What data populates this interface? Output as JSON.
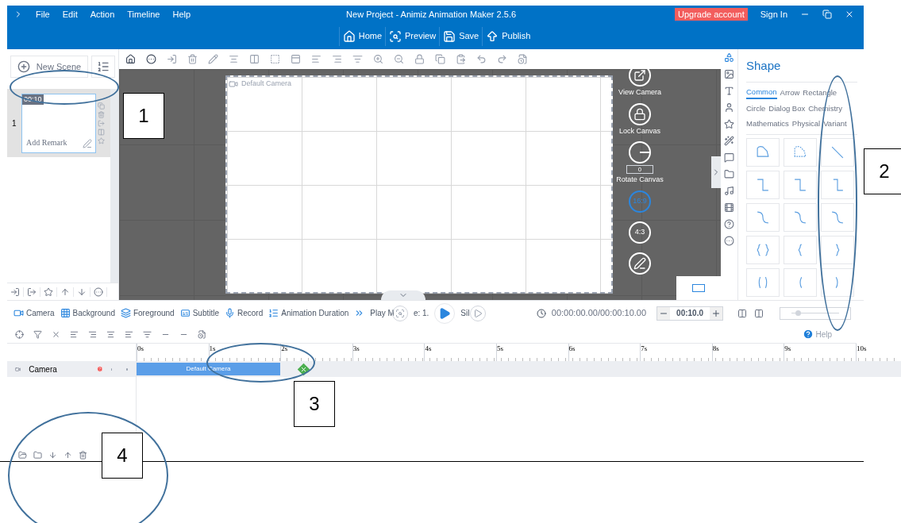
{
  "window": {
    "title": "New Project - Animiz Animation Maker 2.5.6",
    "upgrade": "Upgrade account",
    "sign_in": "Sign In"
  },
  "menu": [
    "File",
    "Edit",
    "Action",
    "Timeline",
    "Help"
  ],
  "main_toolbar": [
    {
      "label": "Home",
      "kind": "home"
    },
    {
      "label": "Preview",
      "kind": "preview"
    },
    {
      "label": "Save",
      "kind": "save"
    },
    {
      "label": "Publish",
      "kind": "publish"
    }
  ],
  "scene_panel": {
    "new_scene": "New Scene",
    "scenes": [
      {
        "number": "1",
        "duration": "00:10",
        "remark": "Add Remark",
        "selected": true
      }
    ]
  },
  "canvas": {
    "camera_label": "Default Camera",
    "controls": [
      {
        "label": "View Camera",
        "kind": "view"
      },
      {
        "label": "Lock Canvas",
        "kind": "lock"
      },
      {
        "label": "Rotate Canvas",
        "kind": "rotate",
        "value": "0"
      }
    ],
    "ratios": [
      {
        "label": "16:9",
        "selected": true
      },
      {
        "label": "4:3",
        "selected": false
      }
    ]
  },
  "shape_panel": {
    "title": "Shape",
    "categories": [
      {
        "label": "Common",
        "selected": true
      },
      {
        "label": "Arrow",
        "selected": false
      },
      {
        "label": "Rectangle",
        "selected": false
      },
      {
        "label": "Circle",
        "selected": false
      },
      {
        "label": "Dialog Box",
        "selected": false
      },
      {
        "label": "Chemistry",
        "selected": false
      },
      {
        "label": "Mathematics",
        "selected": false
      },
      {
        "label": "Physical",
        "selected": false
      },
      {
        "label": "Variant",
        "selected": false
      }
    ]
  },
  "timeline_bar": {
    "items": [
      {
        "label": "Camera",
        "kind": "camera"
      },
      {
        "label": "Background",
        "kind": "background"
      },
      {
        "label": "Foreground",
        "kind": "foreground"
      },
      {
        "label": "Subtitle",
        "kind": "subtitle"
      },
      {
        "label": "Record",
        "kind": "record"
      },
      {
        "label": "Animation Duration",
        "kind": "duration"
      }
    ],
    "play_mode": [
      "Play M",
      "e: 1."
    ],
    "silent": "Sil",
    "time": "00:00:00.00/00:00:10.00",
    "duration": "00:10.0",
    "zoom": {
      "level": 0.08
    }
  },
  "help": "Help",
  "ruler": [
    "0s",
    "1s",
    "2s",
    "3s",
    "4s",
    "5s",
    "6s",
    "7s",
    "8s",
    "9s",
    "10s"
  ],
  "tracks": [
    {
      "name": "Camera",
      "clip": "Default Camera"
    }
  ],
  "annotations": [
    "1",
    "2",
    "3",
    "4"
  ]
}
